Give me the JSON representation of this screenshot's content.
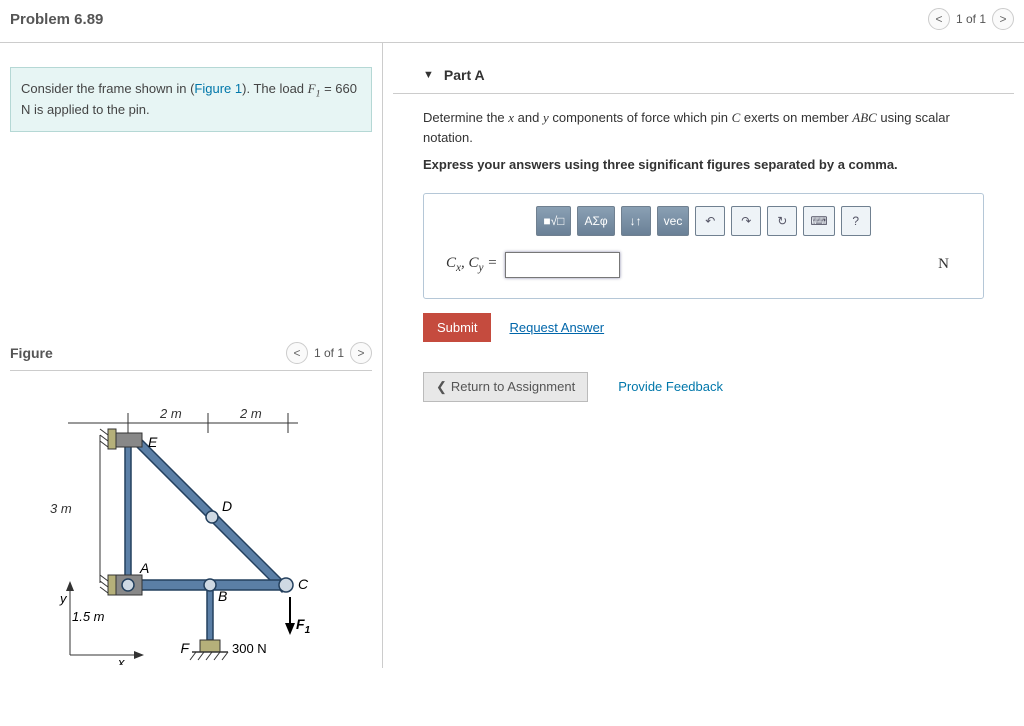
{
  "header": {
    "title": "Problem 6.89",
    "progress": "1 of 1"
  },
  "prompt": {
    "pre": "Consider the frame shown in (",
    "fig_link": "Figure 1",
    "post_fig": "). The load ",
    "var": "F",
    "sub": "1",
    "eq": " = 660  N is applied to the pin."
  },
  "figure": {
    "heading": "Figure",
    "progress": "1 of 1",
    "dims": {
      "span1": "2 m",
      "span2": "2 m",
      "height": "3 m",
      "base": "1.5 m"
    },
    "labels": {
      "E": "E",
      "D": "D",
      "A": "A",
      "B": "B",
      "C": "C",
      "F": "F",
      "F1": "F",
      "F1sub": "1"
    },
    "axes": {
      "x": "x",
      "y": "y"
    },
    "load": "300 N"
  },
  "part": {
    "caret": "▼",
    "label": "Part A",
    "question_pre": "Determine the ",
    "question_x": "x",
    "question_mid1": " and ",
    "question_y": "y",
    "question_mid2": " components of force which pin ",
    "question_C": "C",
    "question_mid3": " exerts on member ",
    "question_ABC": "ABC",
    "question_post": " using scalar notation.",
    "express": "Express your answers using three significant figures separated by a comma.",
    "toolbar": {
      "templates": "■√□",
      "greek": "ΑΣφ",
      "arrows": "↓↑",
      "vec": "vec",
      "undo": "↶",
      "redo": "↷",
      "reset": "↻",
      "keyboard": "⌨",
      "help": "?"
    },
    "lhs_cx": "C",
    "lhs_cx_sub": "x",
    "lhs_cy": "C",
    "lhs_cy_sub": "y",
    "equals": " =",
    "unit": "N",
    "submit": "Submit",
    "request": "Request Answer"
  },
  "footer": {
    "return_icon": "❮",
    "return": "Return to Assignment",
    "feedback": "Provide Feedback"
  }
}
